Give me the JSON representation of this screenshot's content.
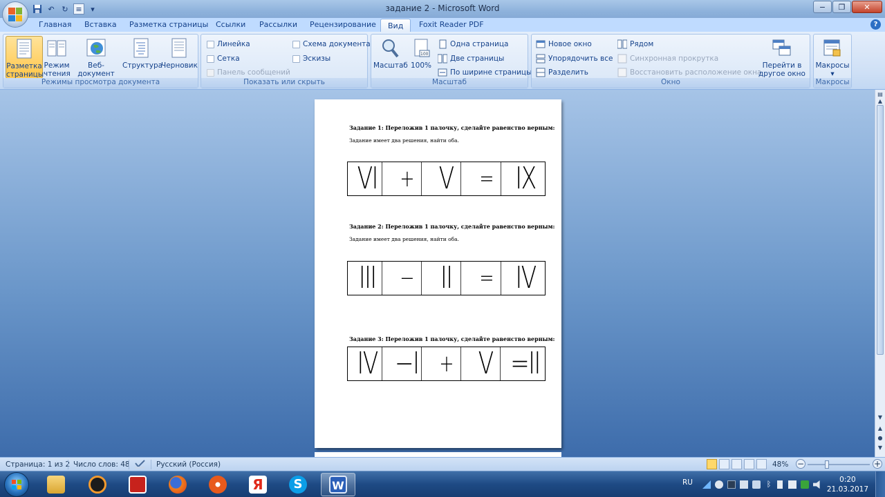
{
  "window": {
    "title": "задание 2 - Microsoft Word",
    "minimize": "−",
    "restore": "❐",
    "close": "✕"
  },
  "qat": {
    "save_icon": "save-icon",
    "undo": "↶",
    "redo": "↻",
    "custom": "≡",
    "more": "▾"
  },
  "tabs": [
    "Главная",
    "Вставка",
    "Разметка страницы",
    "Ссылки",
    "Рассылки",
    "Рецензирование",
    "Вид",
    "Foxit Reader PDF"
  ],
  "active_tab": "Вид",
  "ribbon": {
    "views": {
      "label": "Режимы просмотра документа",
      "buttons": [
        {
          "line1": "Разметка",
          "line2": "страницы",
          "selected": true
        },
        {
          "line1": "Режим",
          "line2": "чтения"
        },
        {
          "line1": "Веб-документ",
          "line2": ""
        },
        {
          "line1": "Структура",
          "line2": ""
        },
        {
          "line1": "Черновик",
          "line2": ""
        }
      ]
    },
    "show": {
      "label": "Показать или скрыть",
      "ruler": "Линейка",
      "grid": "Сетка",
      "message_bar": "Панель сообщений",
      "doc_map": "Схема документа",
      "thumbnails": "Эскизы"
    },
    "zoom": {
      "label": "Масштаб",
      "zoom_btn": "Масштаб",
      "zoom100": "100%",
      "one_page": "Одна страница",
      "two_pages": "Две страницы",
      "page_width": "По ширине страницы"
    },
    "window": {
      "label": "Окно",
      "new_window": "Новое окно",
      "arrange_all": "Упорядочить все",
      "split": "Разделить",
      "side_by_side": "Рядом",
      "sync_scroll": "Синхронная прокрутка",
      "reset_pos": "Восстановить расположение окна",
      "switch_line1": "Перейти в",
      "switch_line2": "другое окно ▾"
    },
    "macros": {
      "label": "Макросы",
      "button": "Макросы",
      "arrow": "▾"
    }
  },
  "document": {
    "tasks": [
      {
        "title": "Задание 1: Переложив 1 палочку, сделайте равенство верным:",
        "subtitle": "Задание имеет два решения, найти оба.",
        "cells": [
          "VI",
          "+",
          "V",
          "=",
          "IX"
        ]
      },
      {
        "title": "Задание 2: Переложив 1 палочку, сделайте равенство верным:",
        "subtitle": "Задание имеет два решения, найти оба.",
        "cells": [
          "III",
          "−",
          "II",
          "=",
          "IV"
        ]
      },
      {
        "title": "Задание 3: Переложив 1 палочку, сделайте равенство верным:",
        "subtitle": "",
        "cells": [
          "IV",
          "−I",
          "+",
          "V",
          "=II"
        ]
      }
    ]
  },
  "statusbar": {
    "page": "Страница: 1 из 2",
    "words": "Число слов: 48",
    "language": "Русский (Россия)",
    "zoom": "48%",
    "zoom_minus": "−",
    "zoom_plus": "+",
    "zoom_level_fraction": 0.3
  },
  "taskbar": {
    "apps": [
      "windows-explorer",
      "avast",
      "acrobat",
      "firefox",
      "media-player",
      "yandex-browser",
      "skype",
      "microsoft-word"
    ],
    "active_app": "microsoft-word",
    "lang": "RU",
    "time": "0:20",
    "date": "21.03.2017"
  },
  "colors": {
    "accent": "#15428b",
    "ribbon_bg": "#dbe8f8",
    "workspace": "#6a96c9",
    "selected_button": "#ffc64a"
  }
}
